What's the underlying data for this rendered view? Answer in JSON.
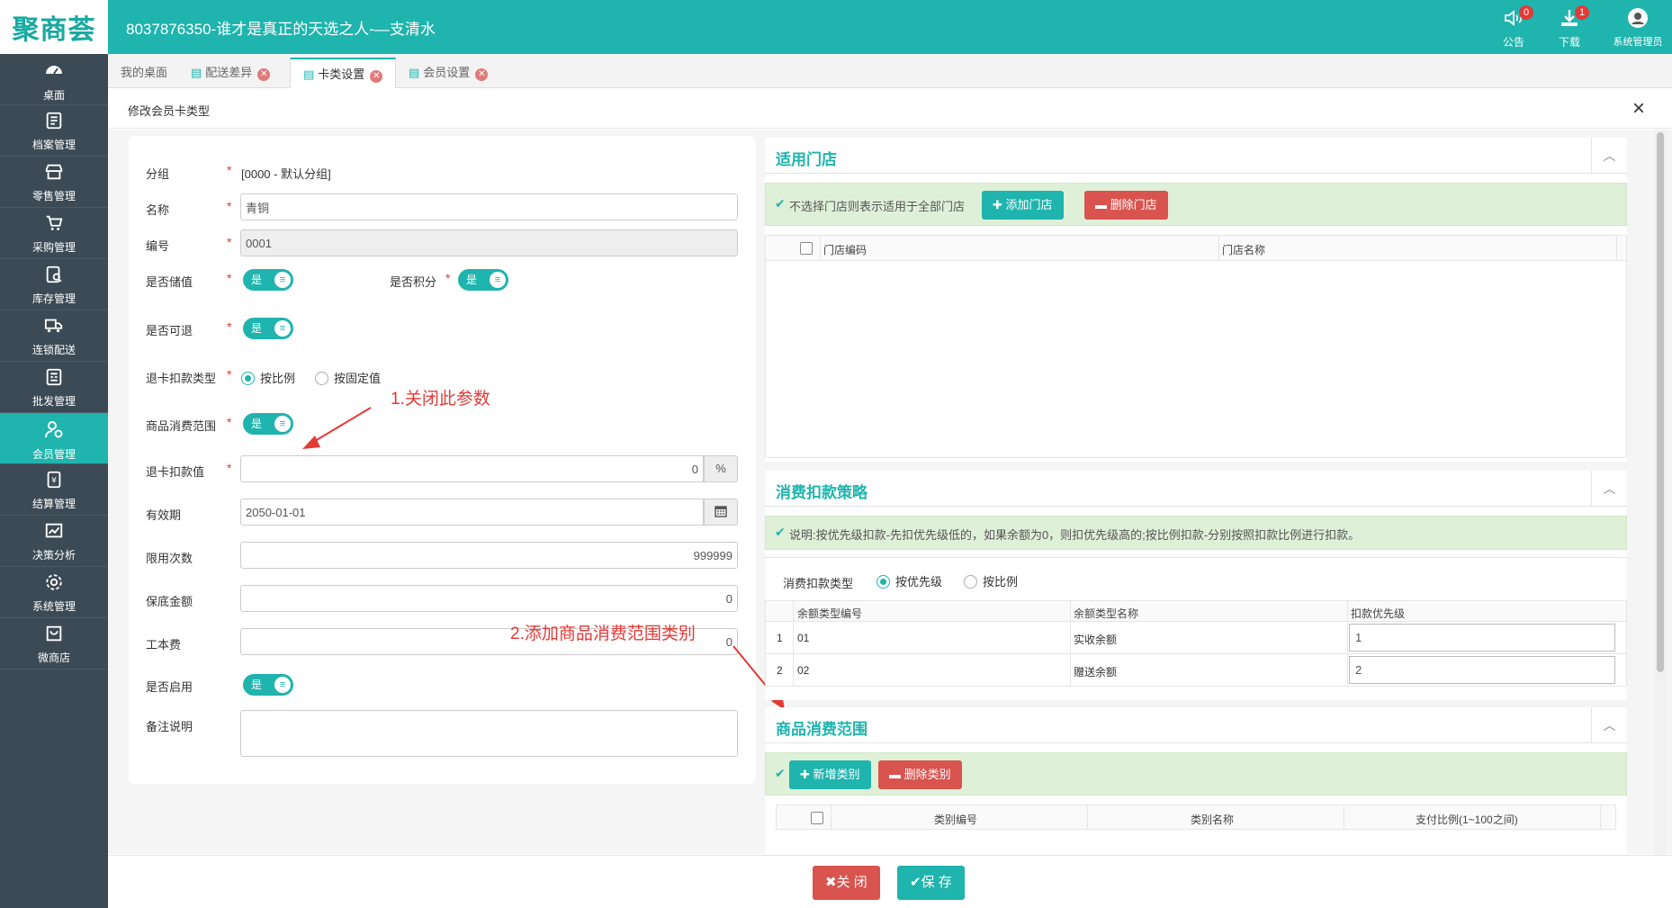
{
  "app": {
    "logo": "聚商荟",
    "title": "8037876350-谁才是真正的天选之人-—支清水"
  },
  "topbar": {
    "notice_label": "公告",
    "notice_count": "0",
    "download_label": "下载",
    "download_count": "1",
    "user_label": "系统管理员"
  },
  "sidebar": {
    "items": [
      {
        "label": "桌面",
        "icon": "dashboard-icon"
      },
      {
        "label": "档案管理",
        "icon": "archive-icon"
      },
      {
        "label": "零售管理",
        "icon": "store-icon"
      },
      {
        "label": "采购管理",
        "icon": "cart-icon"
      },
      {
        "label": "库存管理",
        "icon": "inventory-icon"
      },
      {
        "label": "连锁配送",
        "icon": "truck-icon"
      },
      {
        "label": "批发管理",
        "icon": "wholesale-icon"
      },
      {
        "label": "会员管理",
        "icon": "member-icon"
      },
      {
        "label": "结算管理",
        "icon": "settlement-icon"
      },
      {
        "label": "决策分析",
        "icon": "chart-icon"
      },
      {
        "label": "系统管理",
        "icon": "gear-icon"
      },
      {
        "label": "微商店",
        "icon": "shop-bag-icon"
      }
    ],
    "active_index": 7
  },
  "tabs": [
    {
      "label": "我的桌面"
    },
    {
      "label": "配送差异"
    },
    {
      "label": "卡类设置"
    },
    {
      "label": "会员设置"
    }
  ],
  "dialog": {
    "title": "修改会员卡类型",
    "close": "×"
  },
  "form": {
    "group_label": "分组",
    "group_value": "[0000 - 默认分组]",
    "name_label": "名称",
    "name_value": "青铜",
    "code_label": "编号",
    "code_value": "0001",
    "stored_value_label": "是否储值",
    "points_label": "是否积分",
    "refundable_label": "是否可退",
    "refund_type_label": "退卡扣款类型",
    "refund_type_opt1": "按比例",
    "refund_type_opt2": "按固定值",
    "scope_label": "商品消费范围",
    "refund_value_label": "退卡扣款值",
    "refund_value": "0",
    "refund_value_unit": "%",
    "expire_label": "有效期",
    "expire_value": "2050-01-01",
    "limit_label": "限用次数",
    "limit_value": "999999",
    "min_amount_label": "保底金额",
    "min_amount_value": "0",
    "fee_label": "工本费",
    "fee_value": "0",
    "enabled_label": "是否启用",
    "remark_label": "备注说明",
    "toggle_on": "是",
    "required_mark": "*"
  },
  "annotations": {
    "a1": "1.关闭此参数",
    "a2": "2.添加商品消费范围类别"
  },
  "stores_panel": {
    "title": "适用门店",
    "notice": "不选择门店则表示适用于全部门店",
    "add_btn": "添加门店",
    "del_btn": "删除门店",
    "col_code": "门店编码",
    "col_name": "门店名称"
  },
  "strategy_panel": {
    "title": "消费扣款策略",
    "notice": "说明:按优先级扣款-先扣优先级低的，如果余额为0，则扣优先级高的;按比例扣款-分别按照扣款比例进行扣款。",
    "type_label": "消费扣款类型",
    "opt1": "按优先级",
    "opt2": "按比例",
    "col_code": "余额类型编号",
    "col_name": "余额类型名称",
    "col_priority": "扣款优先级",
    "rows": [
      {
        "idx": "1",
        "code": "01",
        "name": "实收余额",
        "priority": "1"
      },
      {
        "idx": "2",
        "code": "02",
        "name": "赠送余额",
        "priority": "2"
      }
    ]
  },
  "scope_panel": {
    "title": "商品消费范围",
    "add_btn": "新增类别",
    "del_btn": "删除类别",
    "col_code": "类别编号",
    "col_name": "类别名称",
    "col_ratio": "支付比例(1~100之间)"
  },
  "footer": {
    "close_btn": "关 闭",
    "save_btn": "保 存"
  },
  "colors": {
    "primary": "#1fb4ad",
    "sidebar": "#3b4a55",
    "danger": "#d9534f",
    "annotation": "#e53935"
  }
}
